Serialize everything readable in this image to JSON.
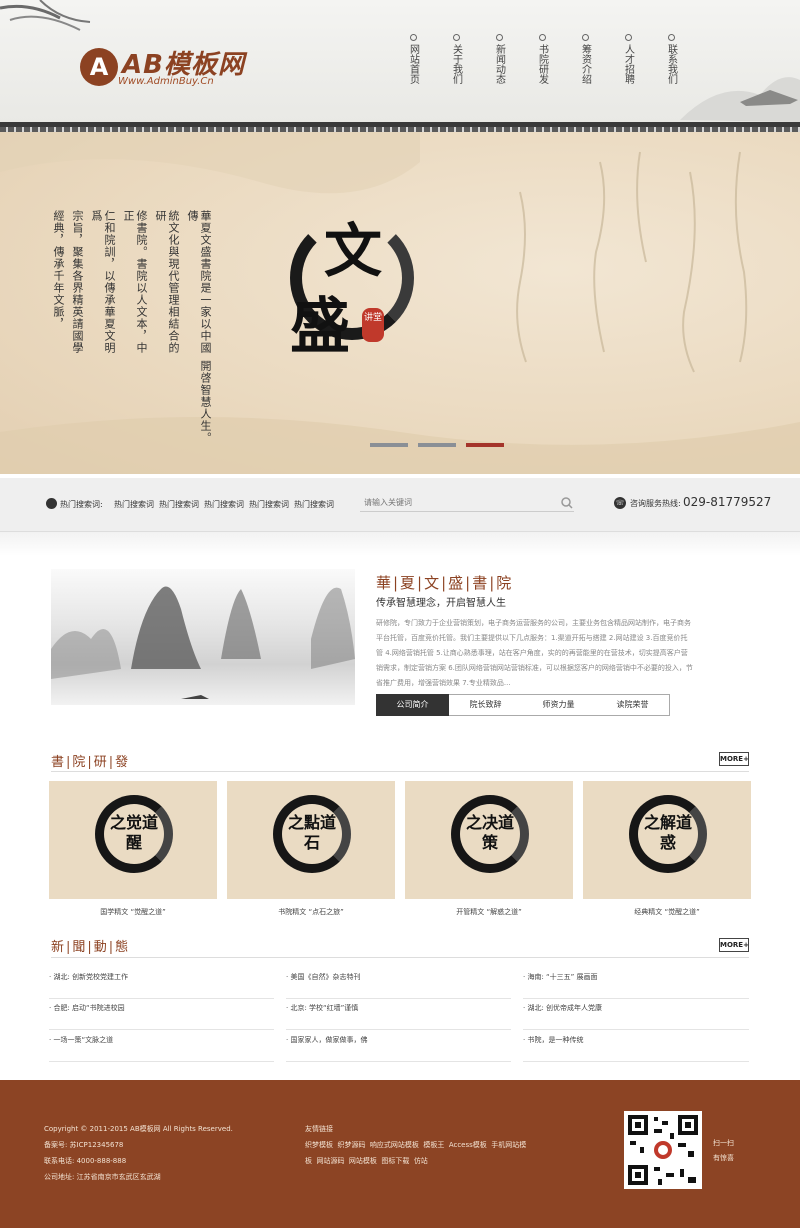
{
  "header": {
    "logo_mark": "A",
    "logo_text": "AB模板网",
    "logo_url": "Www.AdminBuy.Cn",
    "nav": [
      "网站首页",
      "关于我们",
      "新闻动态",
      "书院研发",
      "筹资介绍",
      "人才招聘",
      "联系我们"
    ]
  },
  "banner": {
    "text_columns": [
      "華夏文盛書院是一家以中國傳",
      "統文化與現代管理相結合的研",
      "修書院。書院以人文本，中正",
      "仁和院訓，以傳承華夏文明爲",
      "宗旨，聚集各界精英請國學",
      "經典，傳承千年文脈，",
      "開啓智慧人生。"
    ],
    "ink_char_1": "文",
    "ink_char_2": "盛",
    "seal": "讲堂",
    "active_dot": 2
  },
  "search": {
    "hot_label": "热门搜索词:",
    "hot_words": [
      "热门搜索词",
      "热门搜索词",
      "热门搜索词",
      "热门搜索词",
      "热门搜索词"
    ],
    "placeholder": "请输入关键词",
    "phone_label": "咨询服务热线:",
    "phone": "029-81779527"
  },
  "intro": {
    "title": "華|夏|文|盛|書|院",
    "subtitle": "传承智慧理念，开启智慧人生",
    "body": "研修院，专门致力于企业营销策划，电子商务运营服务的公司，主要业务包含精品网站制作，电子商务平台托管，百度竞价托管。我们主要提供以下几点服务：1.渠道开拓与搭建 2.网站建设 3.百度竞价托管 4.网络营销托管 5.让商心熟悉事理，站在客户角度，实的的再营能里的在营技术，切实提高客户营销需求，制定营销方案 6.团队网络营销网站营销标准，可以根据您客户的网络营销中不必要的投入，节省推广费用，增强营销效果 7.专业精致品...",
    "tabs": [
      "公司简介",
      "院长致辞",
      "师资力量",
      "读院荣誉"
    ],
    "active_tab": 0
  },
  "research": {
    "title": "書|院|研|發",
    "more": "MORE+",
    "cards": [
      {
        "ink": "之觉道醒",
        "caption": "国学精文 “觉醒之道”"
      },
      {
        "ink": "之點道石",
        "caption": "书院精文 “点石之旅”"
      },
      {
        "ink": "之决道策",
        "caption": "开管精文 “解惑之道”"
      },
      {
        "ink": "之解道惑",
        "caption": "经典精文 “觉醒之道”"
      }
    ]
  },
  "news": {
    "title": "新|聞|動|態",
    "more": "MORE+",
    "items": [
      "湖北: 创新党校党建工作",
      "美国《自然》杂志特刊",
      "海南: “十三五” 展画面",
      "合肥: 启动“书院进校园",
      "北京: 学校“红墙”谨慎",
      "湖北: 创优帝成年人党康",
      "一场一策“文脉之道",
      "国家家人，做家做事，佛",
      "书院，是一种传统"
    ]
  },
  "footer": {
    "copyright": "Copyright © 2011-2015 AB模板网 All Rights Reserved.",
    "icp": "备案号: 苏ICP12345678",
    "tel": "联系电话: 4000-888-888",
    "address": "公司地址: 江苏省南京市玄武区玄武湖",
    "links_title": "友情链接",
    "links_row1": [
      "织梦模板",
      "织梦源码",
      "响应式网站模板",
      "模板王",
      "Access模板",
      "手机网站模"
    ],
    "links_row2": [
      "板",
      "网站源码",
      "网站模板",
      "图标下载",
      "仿站"
    ],
    "qr_caption_1": "扫一扫",
    "qr_caption_2": "有惊喜"
  },
  "colors": {
    "brand": "#8c4222",
    "footer_bg": "#8c4424",
    "banner_bg": "#ead9bf"
  }
}
